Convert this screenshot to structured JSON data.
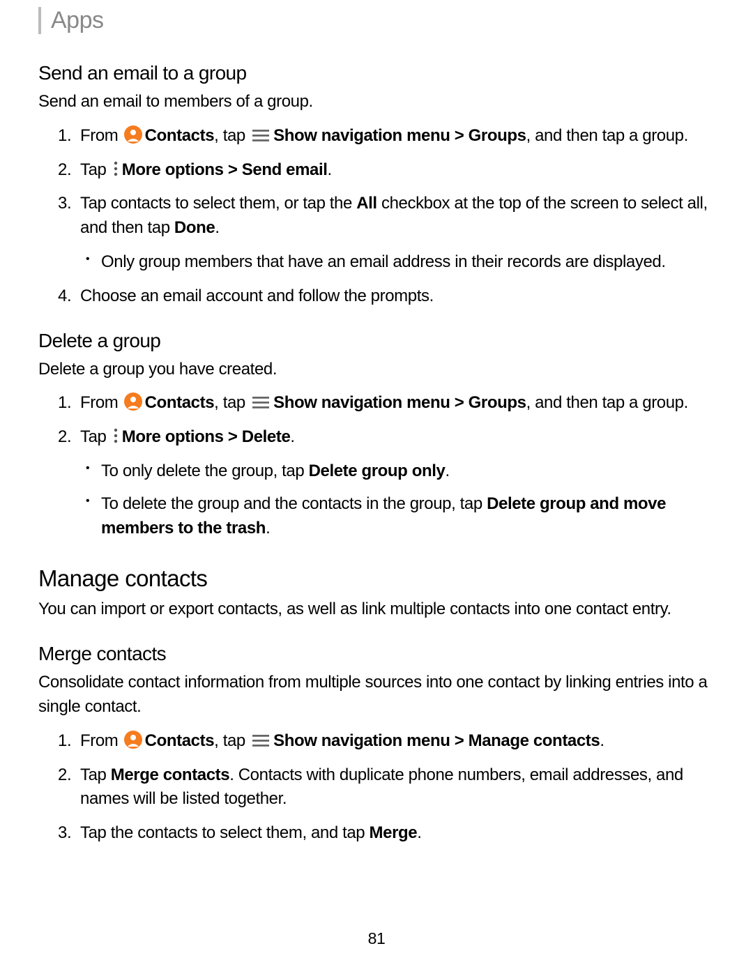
{
  "breadcrumb": "Apps",
  "section1": {
    "title": "Send an email to a group",
    "intro": "Send an email to members of a group.",
    "step1": {
      "from": "From ",
      "contacts": "Contacts",
      "tap": ", tap ",
      "menu": "Show navigation menu > Groups",
      "rest": ", and then tap a group."
    },
    "step2": {
      "tap": "Tap ",
      "more": "More options > Send email",
      "dot": "."
    },
    "step3": {
      "a": "Tap contacts to select them, or tap the ",
      "all": "All",
      "b": " checkbox at the top of the screen to select all, and then tap ",
      "done": "Done",
      "dot": ".",
      "sub": "Only group members that have an email address in their records are displayed."
    },
    "step4": "Choose an email account and follow the prompts."
  },
  "section2": {
    "title": "Delete a group",
    "intro": "Delete a group you have created.",
    "step1": {
      "from": "From ",
      "contacts": "Contacts",
      "tap": ", tap ",
      "menu": "Show navigation menu > Groups",
      "rest": ", and then tap a group."
    },
    "step2": {
      "tap": "Tap ",
      "more": "More options > Delete",
      "dot": ".",
      "sub1a": "To only delete the group, tap ",
      "sub1b": "Delete group only",
      "sub1c": ".",
      "sub2a": "To delete the group and the contacts in the group, tap ",
      "sub2b": "Delete group and move members to the trash",
      "sub2c": "."
    }
  },
  "section3": {
    "title": "Manage contacts",
    "intro": "You can import or export contacts, as well as link multiple contacts into one contact entry."
  },
  "section4": {
    "title": "Merge contacts",
    "intro": "Consolidate contact information from multiple sources into one contact by linking entries into a single contact.",
    "step1": {
      "from": "From ",
      "contacts": "Contacts",
      "tap": ", tap ",
      "menu": "Show navigation menu > Manage contacts",
      "dot": "."
    },
    "step2": {
      "a": "Tap ",
      "b": "Merge contacts",
      "c": ". Contacts with duplicate phone numbers, email addresses, and names will be listed together."
    },
    "step3": {
      "a": "Tap the contacts to select them, and tap ",
      "b": "Merge",
      "c": "."
    }
  },
  "pagenum": "81"
}
